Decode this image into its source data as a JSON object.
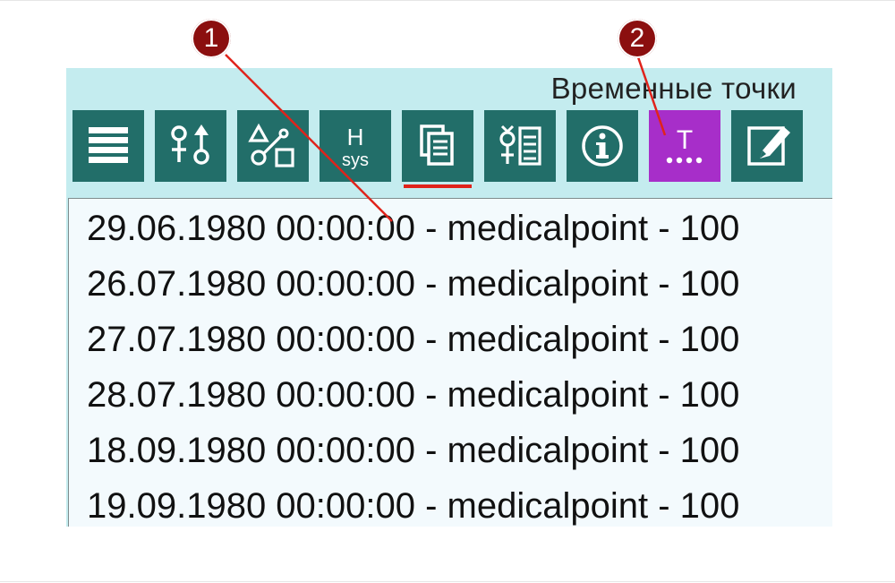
{
  "panel": {
    "title": "Временные точки"
  },
  "toolbar": {
    "buttons": [
      {
        "icon": "menu-lines-icon"
      },
      {
        "icon": "gender-symbols-icon"
      },
      {
        "icon": "shapes-icon"
      },
      {
        "icon": "h-sys-icon",
        "label_top": "H",
        "label_bottom": "sys"
      },
      {
        "icon": "copy-pages-icon",
        "active_underline": true
      },
      {
        "icon": "gender-list-icon"
      },
      {
        "icon": "info-icon"
      },
      {
        "icon": "timepoints-icon",
        "label": "T",
        "selected": true
      },
      {
        "icon": "edit-icon"
      }
    ]
  },
  "timepoints": [
    "29.06.1980 00:00:00 - medicalpoint - 100",
    "26.07.1980 00:00:00 - medicalpoint - 100",
    "27.07.1980 00:00:00 - medicalpoint - 100",
    "28.07.1980 00:00:00 - medicalpoint - 100",
    "18.09.1980 00:00:00 - medicalpoint - 100",
    "19.09.1980 00:00:00 - medicalpoint - 100"
  ],
  "annotations": [
    {
      "label": "1"
    },
    {
      "label": "2"
    }
  ],
  "colors": {
    "panel_bg": "#c4ecef",
    "tool_bg": "#226e69",
    "tool_selected": "#a72ec9",
    "active_underline": "#e0231b",
    "marker": "#8b0f0f",
    "leader_line": "#e0231b"
  }
}
